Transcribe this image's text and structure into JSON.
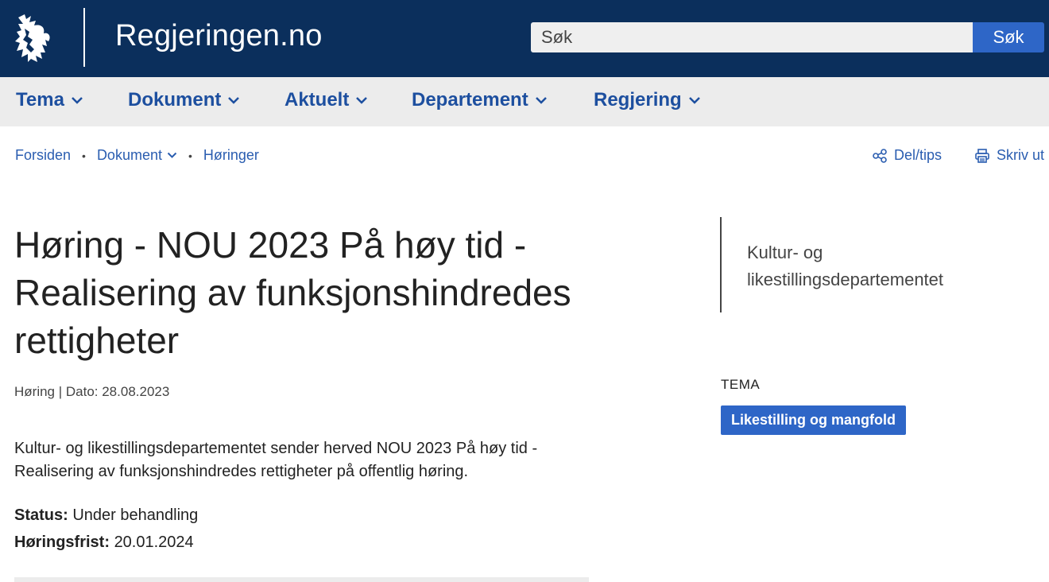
{
  "header": {
    "site_title": "Regjeringen.no",
    "search_placeholder": "Søk",
    "search_button": "Søk",
    "logo_icon": "coat-of-arms-lion-icon"
  },
  "nav": {
    "items": [
      {
        "label": "Tema"
      },
      {
        "label": "Dokument"
      },
      {
        "label": "Aktuelt"
      },
      {
        "label": "Departement"
      },
      {
        "label": "Regjering"
      }
    ]
  },
  "breadcrumb": {
    "items": [
      "Forsiden",
      "Dokument",
      "Høringer"
    ],
    "separator": "•"
  },
  "tools": {
    "share": "Del/tips",
    "print": "Skriv ut"
  },
  "article": {
    "title": "Høring - NOU 2023 På høy tid - Realisering av funksjonshindredes rettigheter",
    "meta": "Høring | Dato: 28.08.2023",
    "lead": "Kultur- og likestillingsdepartementet sender herved NOU 2023 På høy tid - Realisering av funksjonshindredes rettigheter på offentlig høring.",
    "status_label": "Status:",
    "status_value": "Under behandling",
    "deadline_label": "Høringsfrist:",
    "deadline_value": "20.01.2024"
  },
  "sidebar": {
    "department": "Kultur- og likestillingsdepartementet",
    "tema_heading": "TEMA",
    "tema_tag": "Likestilling og mangfold"
  },
  "colors": {
    "header_bg": "#0b2f5c",
    "accent": "#2e66c7",
    "link": "#2a5db0",
    "nav_bg": "#ececec"
  }
}
